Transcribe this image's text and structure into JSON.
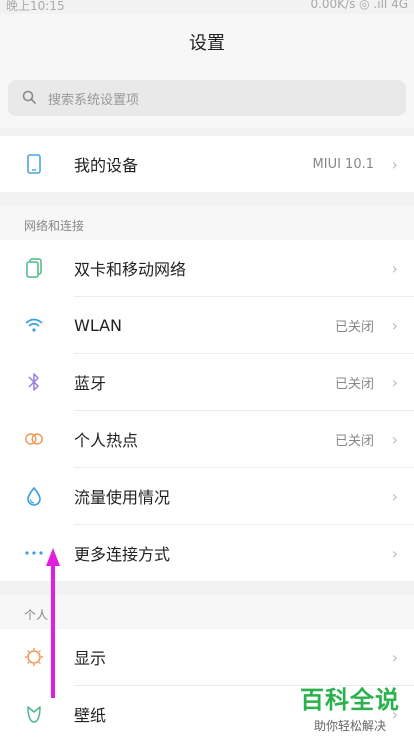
{
  "status_bar": {
    "time": "晚上10:15",
    "right": "0.00K/s ◎ .ıll 4G"
  },
  "header": {
    "title": "设置"
  },
  "search": {
    "placeholder": "搜索系统设置项",
    "icon": "search-icon"
  },
  "device": {
    "label": "我的设备",
    "value": "MIUI 10.1",
    "icon": "phone-icon"
  },
  "sections": [
    {
      "title": "网络和连接",
      "items": [
        {
          "label": "双卡和移动网络",
          "value": "",
          "icon": "dual-sim-icon"
        },
        {
          "label": "WLAN",
          "value": "已关闭",
          "icon": "wifi-icon"
        },
        {
          "label": "蓝牙",
          "value": "已关闭",
          "icon": "bluetooth-icon"
        },
        {
          "label": "个人热点",
          "value": "已关闭",
          "icon": "hotspot-icon"
        },
        {
          "label": "流量使用情况",
          "value": "",
          "icon": "data-usage-icon"
        },
        {
          "label": "更多连接方式",
          "value": "",
          "icon": "more-icon"
        }
      ]
    },
    {
      "title": "个人",
      "items": [
        {
          "label": "显示",
          "value": "",
          "icon": "display-icon"
        },
        {
          "label": "壁纸",
          "value": "",
          "icon": "wallpaper-icon"
        }
      ]
    }
  ],
  "watermark": {
    "main": "百科全说",
    "sub": "助你轻松解决"
  },
  "colors": {
    "accent": "#2bb24c",
    "arrow": "#e11de0"
  }
}
